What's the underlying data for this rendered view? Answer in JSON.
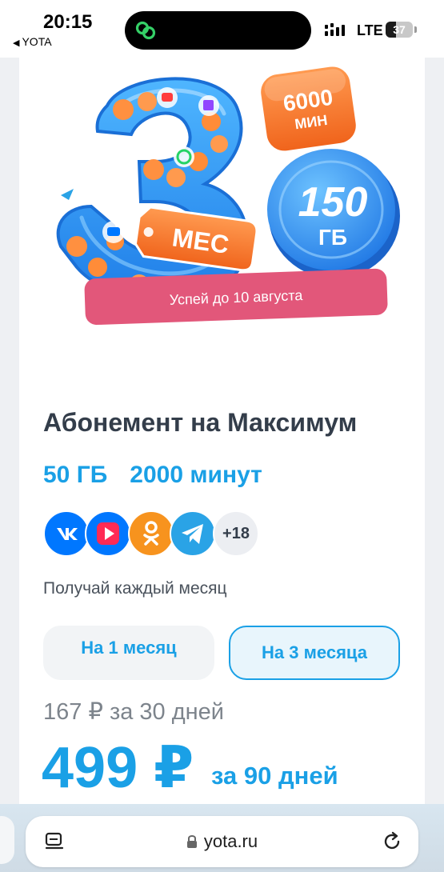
{
  "status_bar": {
    "time": "20:15",
    "back_app": "YOTA",
    "network": "LTE",
    "battery": "37",
    "battery_level": 0.37
  },
  "promo": {
    "number": "3",
    "tag": "МЕС",
    "minutes_value": "6000",
    "minutes_unit": "МИН",
    "gb_value": "150",
    "gb_unit": "ГБ",
    "banner": "Успей до 10 августа"
  },
  "plan": {
    "title": "Абонемент на Максимум",
    "features": [
      "50 ГБ",
      "2000 минут"
    ],
    "apps": [
      "vk-icon",
      "vk-video-icon",
      "odnoklassniki-icon",
      "telegram-icon"
    ],
    "more_apps": "+18",
    "subtitle": "Получай каждый месяц",
    "periods": [
      "На 1 месяц",
      "На 3 месяца"
    ],
    "selected_period": "На 3 месяца",
    "old_price": "167 ₽ за 30 дней",
    "price": "499 ₽",
    "price_period": "за 90 дней"
  },
  "browser": {
    "url": "yota.ru"
  },
  "colors": {
    "brand_blue": "#1aa0e6",
    "promo_orange": "#f57a2a",
    "promo_pink": "#e2577a"
  }
}
